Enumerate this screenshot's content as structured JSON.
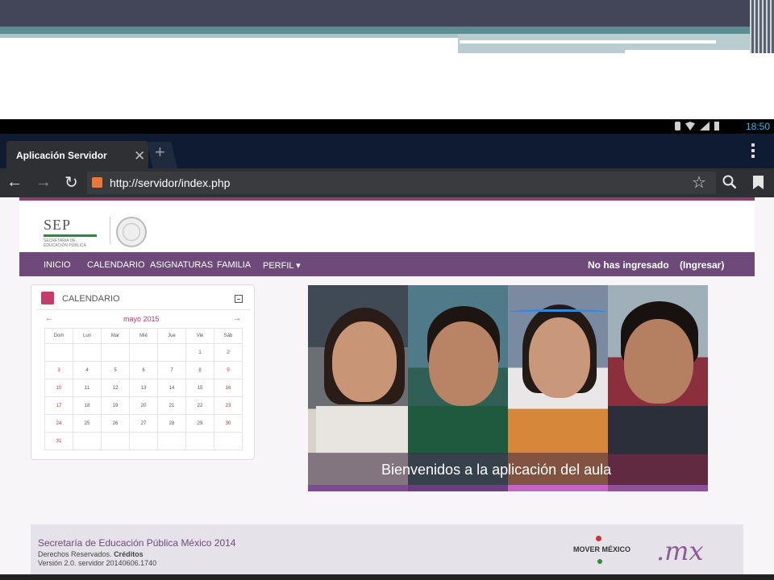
{
  "status_bar": {
    "time": "18:50"
  },
  "browser": {
    "tab_title": "Aplicación Servidor",
    "tab_close": "✕",
    "new_tab": "+",
    "url": "http://servidor/index.php",
    "back": "←",
    "forward": "→",
    "reload": "↻",
    "star": "☆"
  },
  "header": {
    "logo_word": "SEP",
    "logo_sub": "SECRETARÍA DE EDUCACIÓN PÚBLICA"
  },
  "nav": {
    "items": [
      "INICIO",
      "CALENDARIO",
      "ASIGNATURAS",
      "FAMILIA",
      "PERFIL ▾"
    ],
    "login_status": "No has ingresado",
    "login_link": "(Ingresar)"
  },
  "calendar": {
    "title": "CALENDARIO",
    "month": "mayo 2015",
    "prev": "←",
    "next": "→",
    "weekdays": [
      "Dom",
      "Lun",
      "Mar",
      "Mié",
      "Jue",
      "Vie",
      "Sáb"
    ],
    "weeks": [
      [
        "",
        "",
        "",
        "",
        "",
        "1",
        "2"
      ],
      [
        "3",
        "4",
        "5",
        "6",
        "7",
        "8",
        "9"
      ],
      [
        "10",
        "11",
        "12",
        "13",
        "14",
        "15",
        "16"
      ],
      [
        "17",
        "18",
        "19",
        "20",
        "21",
        "22",
        "23"
      ],
      [
        "24",
        "25",
        "26",
        "27",
        "28",
        "29",
        "30"
      ],
      [
        "31",
        "",
        "",
        "",
        "",
        "",
        ""
      ]
    ]
  },
  "banner": {
    "caption": "Bienvenidos a la aplicación del aula"
  },
  "footer": {
    "title": "Secretaría de Educación Pública México 2014",
    "rights": "Derechos Reservados.",
    "credits": "Créditos",
    "version": "Versión 2.0. servidor 20140606.1740",
    "mover_logo": "MOVER MÉXICO",
    "mx_logo": ".mx"
  },
  "colors": {
    "nav_bg": "#6d4a7a",
    "accent": "#b03a6b",
    "browser_chrome": "#2f3033"
  }
}
